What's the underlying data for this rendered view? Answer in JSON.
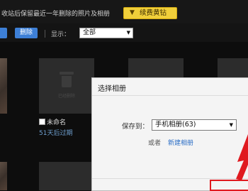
{
  "topbar": {
    "notice": "收站后保留最近一年删除的照片及相册",
    "vip_button": {
      "icon": "trophy-icon",
      "label": "续费黄钻"
    }
  },
  "toolbar": {
    "delete_label": "删除",
    "show_label": "显示：",
    "filter_value": "全部"
  },
  "tile": {
    "name": "未命名",
    "expire": "51天后过期",
    "deleted_caption": "已经删除"
  },
  "dialog": {
    "title": "选择相册",
    "save_to_label": "保存到：",
    "album_value": "手机相册(63)",
    "or_label": "或者",
    "new_album_link": "新建相册"
  },
  "colors": {
    "accent_blue": "#3d7fd6",
    "vip_yellow": "#f0cf3a",
    "annotation_red": "#e0191f"
  }
}
